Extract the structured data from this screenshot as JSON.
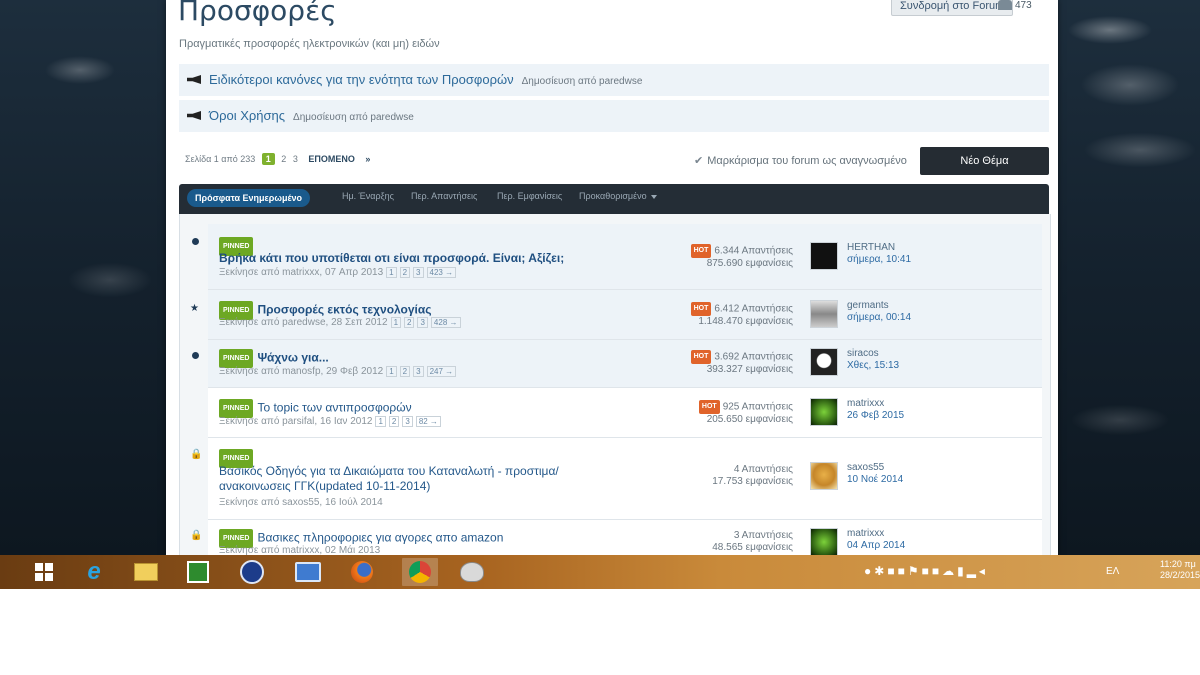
{
  "forum": {
    "title": "Προσφορές",
    "description": "Πραγματικές προσφορές ηλεκτρονικών (και μη) ειδών",
    "subscribe_label": "Συνδρομή στο Forum",
    "watchers": "473"
  },
  "announcements": [
    {
      "title": "Ειδικότεροι κανόνες για την ενότητα των Προσφορών",
      "by": "Δημοσίευση από paredwse"
    },
    {
      "title": "Όροι Χρήσης",
      "by": "Δημοσίευση από paredwse"
    }
  ],
  "pager": {
    "label": "Σελίδα 1 από 233",
    "pages": [
      "1",
      "2",
      "3"
    ],
    "next": "ΕΠΟΜΕΝΟ",
    "last": "»"
  },
  "mark_read": "Μαρκάρισμα του forum ως αναγνωσμένο",
  "new_topic": "Νέο Θέμα",
  "sort_tabs": [
    "Πρόσφατα Ενημερωμένο",
    "Ημ. Έναρξης",
    "Περ. Απαντήσεις",
    "Περ. Εμφανίσεις",
    "Προκαθορισμένο"
  ],
  "pinned_label": "PINNED",
  "hot_label": "HOT",
  "topics": [
    {
      "title": "Βρήκα κάτι που υποτίθεται οτι είναι προσφορά. Είναι; Αξίζει;",
      "meta": "Ξεκίνησε από matrixxx, 07 Απρ 2013",
      "pages": [
        "1",
        "2",
        "3",
        "423 →"
      ],
      "replies": "6.344 Απαντήσεις",
      "views": "875.690 εμφανίσεις",
      "last_user": "HERTHAN",
      "last_time": "σήμερα, 10:41"
    },
    {
      "title": "Προσφορές εκτός τεχνολογίας",
      "meta": "Ξεκίνησε από paredwse, 28 Σεπ 2012",
      "pages": [
        "1",
        "2",
        "3",
        "428 →"
      ],
      "replies": "6.412 Απαντήσεις",
      "views": "1.148.470 εμφανίσεις",
      "last_user": "germants",
      "last_time": "σήμερα, 00:14"
    },
    {
      "title": "Ψάχνω για...",
      "meta": "Ξεκίνησε από manosfp, 29 Φεβ 2012",
      "pages": [
        "1",
        "2",
        "3",
        "247 →"
      ],
      "replies": "3.692 Απαντήσεις",
      "views": "393.327 εμφανίσεις",
      "last_user": "siracos",
      "last_time": "Χθες, 15:13"
    },
    {
      "title": "Το topic των αντιπροσφορών",
      "meta": "Ξεκίνησε από parsifal, 16 Ιαν 2012",
      "pages": [
        "1",
        "2",
        "3",
        "82 →"
      ],
      "replies": "925 Απαντήσεις",
      "views": "205.650 εμφανίσεις",
      "last_user": "matrixxx",
      "last_time": "26 Φεβ 2015"
    },
    {
      "title": "Βασικός Οδηγός για τα Δικαιώματα του Καταναλωτή - προστιμα/ ανακοινωσεις ΓΓΚ(updated 10-11-2014)",
      "meta": "Ξεκίνησε από saxos55, 16 Ιούλ 2014",
      "replies": "4 Απαντήσεις",
      "views": "17.753 εμφανίσεις",
      "last_user": "saxos55",
      "last_time": "10 Νοέ 2014"
    },
    {
      "title": "Βασικες πληροφοριες για αγορες απο amazon",
      "meta": "Ξεκίνησε από matrixxx, 02 Μάι 2013",
      "replies": "3 Απαντήσεις",
      "views": "48.565 εμφανίσεις",
      "last_user": "matrixxx",
      "last_time": "04 Απρ 2014"
    }
  ],
  "taskbar": {
    "lang": "ΕΛ",
    "time": "11:20 πμ",
    "date": "28/2/2015"
  }
}
